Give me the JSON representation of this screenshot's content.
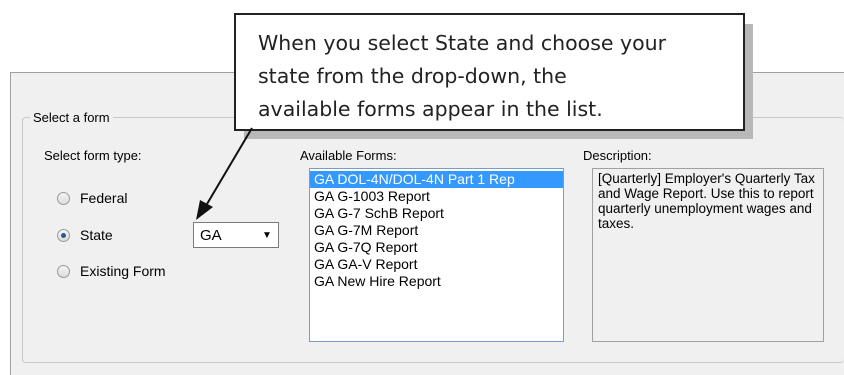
{
  "group_title": "Select a form",
  "form_type_label": "Select form type:",
  "radios": [
    {
      "label": "Federal",
      "checked": false
    },
    {
      "label": "State",
      "checked": true
    },
    {
      "label": "Existing Form",
      "checked": false
    }
  ],
  "state_combo": {
    "value": "GA",
    "arrow": "▼"
  },
  "available_forms": {
    "label": "Available Forms:",
    "items": [
      "GA DOL-4N/DOL-4N Part 1 Rep",
      "GA G-1003 Report",
      "GA G-7 SchB Report",
      "GA G-7M Report",
      "GA G-7Q Report",
      "GA GA-V Report",
      "GA New Hire Report"
    ],
    "selected_index": 0
  },
  "description": {
    "label": "Description:",
    "text": "[Quarterly] Employer's Quarterly Tax and Wage Report.  Use this to report quarterly unemployment wages and taxes."
  },
  "callout": {
    "lines": [
      "When you select State and choose your",
      "state from the drop-down, the",
      "available forms appear in the list."
    ]
  },
  "colors": {
    "selection": "#3399ff",
    "dialog_bg": "#f0f0f0",
    "list_border": "#7a9cc6"
  }
}
